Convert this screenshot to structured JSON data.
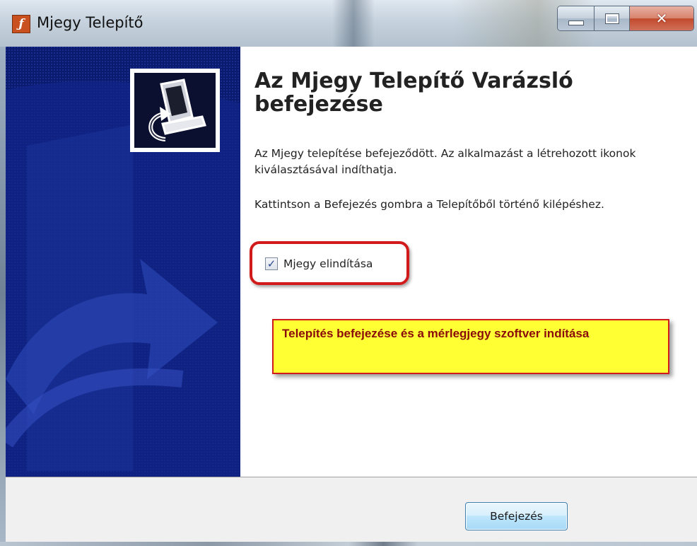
{
  "window": {
    "title": "Mjegy Telepítő",
    "app_icon": "flash-installer-icon",
    "controls": {
      "minimize_icon": "minimize-icon",
      "maximize_icon": "maximize-icon",
      "close_icon": "close-icon",
      "close_glyph": "✕"
    }
  },
  "sidebar": {
    "icon": "computer-setup-icon"
  },
  "content": {
    "heading": "Az Mjegy Telepítő Varázsló befejezése",
    "paragraph1": "Az Mjegy telepítése befejeződött. Az alkalmazást a létrehozott ikonok kiválasztásával indíthatja.",
    "paragraph2": "Kattintson a Befejezés gombra a Telepítőből történő kilépéshez.",
    "launch_checkbox": {
      "label": "Mjegy elindítása",
      "checked": true,
      "check_glyph": "✓"
    }
  },
  "annotation": {
    "callout_text": "Telepítés befejezése és a mérlegjegy szoftver indítása",
    "highlight_color": "#d11b1b",
    "callout_color": "#ffff33"
  },
  "footer": {
    "finish_label": "Befejezés"
  },
  "colors": {
    "sidebar_blue": "#0a1a6e",
    "button_border": "#3c7fb1"
  }
}
